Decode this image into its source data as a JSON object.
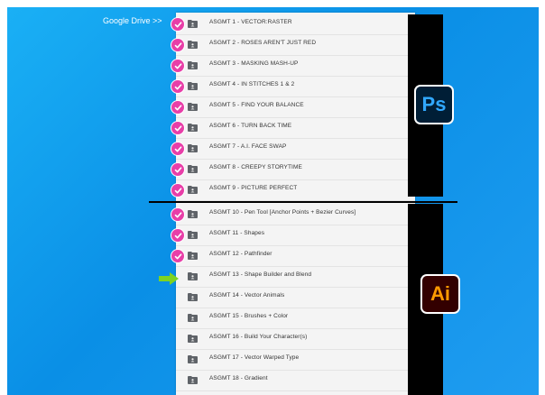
{
  "drive_link": "Google Drive >>",
  "assignments": [
    {
      "label": "ASGMT 1 - VECTOR:RASTER",
      "done": true
    },
    {
      "label": "ASGMT 2 - ROSES AREN'T JUST RED",
      "done": true
    },
    {
      "label": "ASGMT 3 - MASKING MASH-UP",
      "done": true
    },
    {
      "label": "ASGMT 4 - IN STITCHES 1 & 2",
      "done": true
    },
    {
      "label": "ASGMT 5 - FIND YOUR BALANCE",
      "done": true
    },
    {
      "label": "ASGMT 6 - TURN BACK TIME",
      "done": true
    },
    {
      "label": "ASGMT 7 - A.I. FACE SWAP",
      "done": true
    },
    {
      "label": "ASGMT 8 - CREEPY STORYTIME",
      "done": true
    },
    {
      "label": "ASGMT 9 - PICTURE PERFECT",
      "done": true
    },
    {
      "label": "ASGMT 10 - Pen Tool [Anchor Points + Bezier Curves]",
      "done": true
    },
    {
      "label": "ASGMT 11 - Shapes",
      "done": true
    },
    {
      "label": "ASGMT 12 - Pathfinder",
      "done": true
    },
    {
      "label": "ASGMT 13 - Shape Builder and Blend",
      "done": false,
      "current": true
    },
    {
      "label": "ASGMT 14 - Vector Animals",
      "done": false
    },
    {
      "label": "ASGMT 15 - Brushes + Color",
      "done": false
    },
    {
      "label": "ASGMT 16 - Build Your Character(s)",
      "done": false
    },
    {
      "label": "ASGMT 17 - Vector Warped Type",
      "done": false
    },
    {
      "label": "ASGMT 18 - Gradient",
      "done": false
    }
  ],
  "badges": {
    "photoshop": "Ps",
    "illustrator": "Ai"
  },
  "colors": {
    "background": "#0a8fe6",
    "check": "#e83fa8",
    "arrow": "#7ed321",
    "ps_bg": "#001e36",
    "ps_fg": "#31a8ff",
    "ai_bg": "#330000",
    "ai_fg": "#ff9a00"
  },
  "icons": {
    "folder": "shared-folder-icon",
    "check": "checkmark-circle-icon",
    "arrow": "arrow-right-icon"
  }
}
